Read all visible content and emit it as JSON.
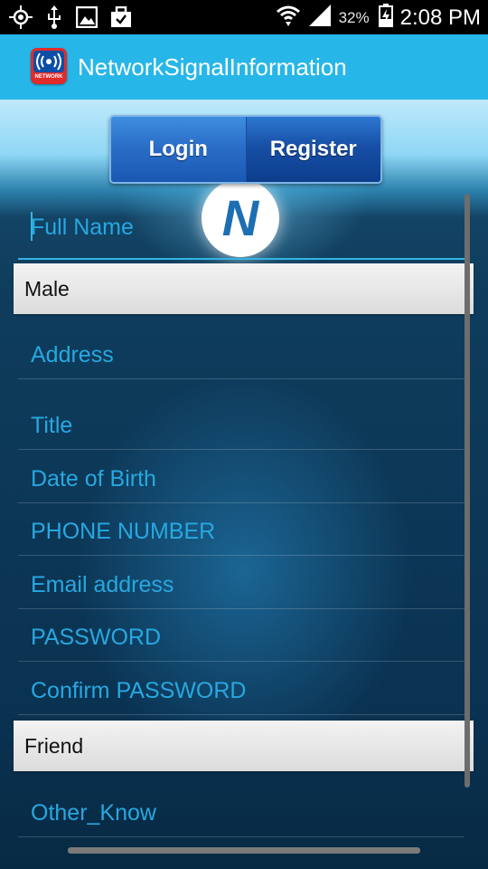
{
  "status_bar": {
    "icons_left": [
      "gps-icon",
      "usb-icon",
      "image-icon",
      "briefcase-icon"
    ],
    "wifi_icon": "wifi-icon",
    "signal_icon": "signal-icon",
    "battery_percent": "32%",
    "battery_icon": "battery-icon",
    "time": "2:08 PM"
  },
  "app_bar": {
    "title": "NetworkSignalInformation",
    "icon_label": "NETWORK",
    "color": "#27b6e8"
  },
  "tabs": {
    "login": "Login",
    "register": "Register",
    "selected": "Register"
  },
  "form": {
    "full_name_placeholder": "Full Name",
    "gender": "Male",
    "address_placeholder": "Address",
    "title_placeholder": "Title",
    "dob_placeholder": "Date of Birth",
    "phone_placeholder": "PHONE NUMBER",
    "email_placeholder": "Email address",
    "password_placeholder": "PASSWORD",
    "confirm_password_placeholder": "Confirm PASSWORD",
    "referral": "Friend",
    "other_know_placeholder": "Other_Know"
  },
  "colors": {
    "accent": "#33b5e5",
    "hint_text": "#27a8e0",
    "spinner_bg": "#e6e6e6"
  }
}
